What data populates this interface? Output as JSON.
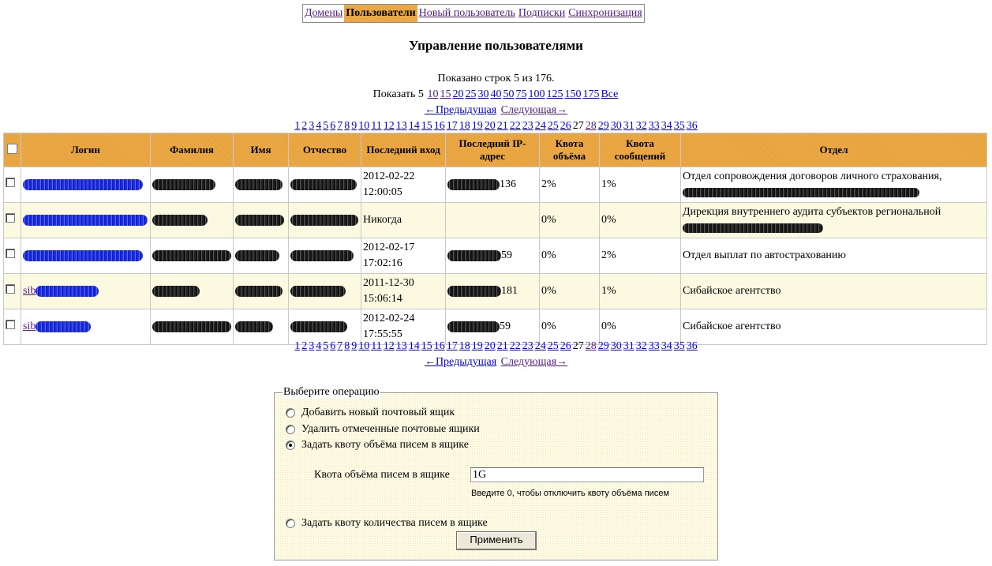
{
  "nav": {
    "items": [
      {
        "label": "Домены",
        "active": false
      },
      {
        "label": "Пользователи",
        "active": true
      },
      {
        "label": "Новый пользователь",
        "active": false
      },
      {
        "label": "Подписки",
        "active": false
      },
      {
        "label": "Синхронизация",
        "active": false
      }
    ]
  },
  "title": "Управление пользователями",
  "summary": "Показано строк 5 из 176.",
  "page_size": {
    "prefix": "Показать 5",
    "options": [
      "10",
      "15",
      "20",
      "25",
      "30",
      "40",
      "50",
      "75",
      "100",
      "125",
      "150",
      "175",
      "Все"
    ]
  },
  "pager": {
    "prev": "←Предыдущая",
    "next": "Следующая→",
    "current": "27",
    "pages": [
      "1",
      "2",
      "3",
      "4",
      "5",
      "6",
      "7",
      "8",
      "9",
      "10",
      "11",
      "12",
      "13",
      "14",
      "15",
      "16",
      "17",
      "18",
      "19",
      "20",
      "21",
      "22",
      "23",
      "24",
      "25",
      "26",
      "27",
      "28",
      "29",
      "30",
      "31",
      "32",
      "33",
      "34",
      "35",
      "36"
    ]
  },
  "table": {
    "headers": {
      "login": "Логин",
      "lastname": "Фамилия",
      "firstname": "Имя",
      "patronymic": "Отчество",
      "lastlogin": "Последний вход",
      "lastip": "Последний IP-адрес",
      "vol_quota": "Квота объёма",
      "msg_quota": "Квота сообщений",
      "dept": "Отдел"
    },
    "rows": [
      {
        "login_prefix": "",
        "lastlogin": "2012-02-22 12:00:05",
        "ip_suffix": "136",
        "vol_quota": "2%",
        "msg_quota": "1%",
        "dept": "Отдел сопровождения договоров личного страхования,"
      },
      {
        "login_prefix": "",
        "lastlogin": "Никогда",
        "ip_suffix": "",
        "vol_quota": "0%",
        "msg_quota": "0%",
        "dept": "Дирекция внутреннего аудита субъектов региональной"
      },
      {
        "login_prefix": "",
        "lastlogin": "2012-02-17 17:02:16",
        "ip_suffix": "59",
        "vol_quota": "0%",
        "msg_quota": "2%",
        "dept": "Отдел выплат по автострахованию"
      },
      {
        "login_prefix": "sib",
        "lastlogin": "2011-12-30 15:06:14",
        "ip_suffix": "181",
        "vol_quota": "0%",
        "msg_quota": "1%",
        "dept": "Сибайское агентство"
      },
      {
        "login_prefix": "sib",
        "lastlogin": "2012-02-24 17:55:55",
        "ip_suffix": "59",
        "vol_quota": "0%",
        "msg_quota": "0%",
        "dept": "Сибайское агентство"
      }
    ]
  },
  "operations": {
    "legend": "Выберите операцию",
    "options": [
      {
        "label": "Добавить новый почтовый ящик",
        "checked": false
      },
      {
        "label": "Удалить отмеченные почтовые ящики",
        "checked": false
      },
      {
        "label": "Задать квоту объёма писем в ящике",
        "checked": true
      },
      {
        "label": "Задать квоту количества писем в ящике",
        "checked": false
      }
    ],
    "quota_label": "Квота объёма писем в ящике",
    "quota_value": "1G",
    "quota_hint": "Введите 0, чтобы отключить квоту объёма писем",
    "apply": "Применить"
  }
}
